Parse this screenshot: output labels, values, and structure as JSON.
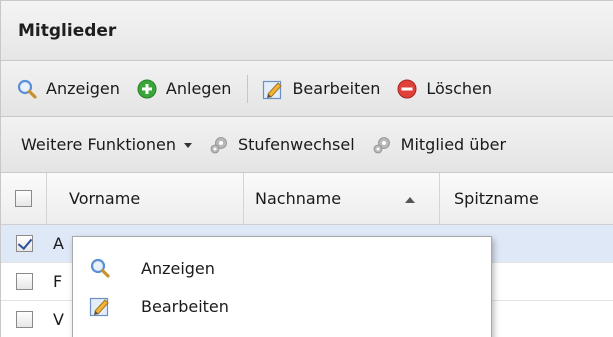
{
  "panel": {
    "title": "Mitglieder"
  },
  "toolbar1": {
    "buttons": [
      {
        "label": "Anzeigen",
        "icon": "magnifier-icon"
      },
      {
        "label": "Anlegen",
        "icon": "add-icon"
      },
      {
        "label": "Bearbeiten",
        "icon": "edit-icon"
      },
      {
        "label": "Löschen",
        "icon": "delete-icon"
      }
    ]
  },
  "toolbar2": {
    "more_label": "Weitere Funktionen",
    "buttons": [
      {
        "label": "Stufenwechsel",
        "icon": "gear-icon"
      },
      {
        "label": "Mitglied über",
        "icon": "gear-icon"
      }
    ]
  },
  "grid": {
    "columns": [
      "Vorname",
      "Nachname",
      "Spitzname"
    ],
    "sort": {
      "column": "Nachname",
      "direction": "ascending"
    },
    "rows": [
      {
        "checked": true,
        "first_char": "A"
      },
      {
        "checked": false,
        "first_char": "F"
      },
      {
        "checked": false,
        "first_char": "V"
      }
    ]
  },
  "context_menu": {
    "items": [
      {
        "label": "Anzeigen",
        "icon": "magnifier-icon"
      },
      {
        "label": "Bearbeiten",
        "icon": "edit-icon"
      }
    ]
  },
  "colors": {
    "add_green": "#3aa63a",
    "delete_red": "#e0403a",
    "selected_row": "#dfe8f6",
    "magnifier_blue": "#5b8fd6"
  }
}
